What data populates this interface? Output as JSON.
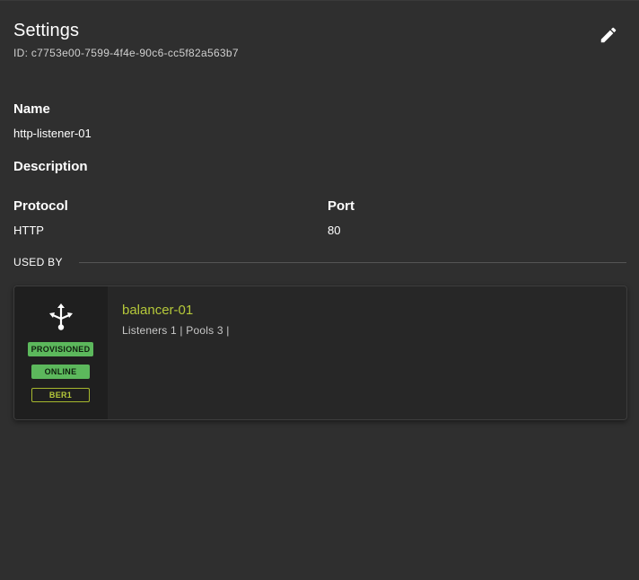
{
  "header": {
    "title": "Settings",
    "id_text": "ID: c7753e00-7599-4f4e-90c6-cc5f82a563b7",
    "edit_icon": "pencil-icon"
  },
  "fields": {
    "name_label": "Name",
    "name_value": "http-listener-01",
    "description_label": "Description",
    "description_value": "",
    "protocol_label": "Protocol",
    "protocol_value": "HTTP",
    "port_label": "Port",
    "port_value": "80"
  },
  "used_by": {
    "label": "USED BY",
    "cards": [
      {
        "icon": "load-balancer-icon",
        "title": "balancer-01",
        "meta": "Listeners 1 | Pools 3 |",
        "badges": {
          "provisioned": "PROVISIONED",
          "online": "ONLINE",
          "region": "BER1"
        }
      }
    ]
  },
  "colors": {
    "background": "#2f2f2f",
    "card": "#272727",
    "accent": "#b5c83a",
    "status_green": "#5cb85c"
  }
}
